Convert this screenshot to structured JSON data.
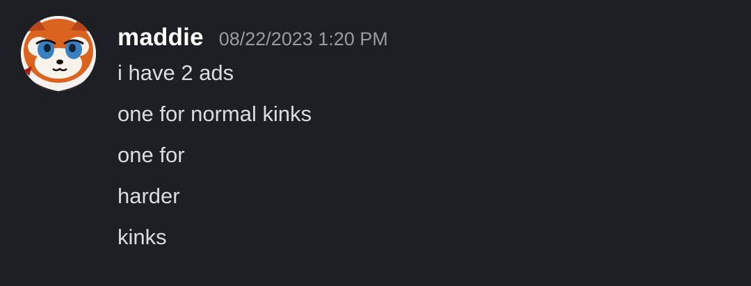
{
  "message": {
    "username": "maddie",
    "timestamp": "08/22/2023 1:20 PM",
    "avatar_icon": "red-panda-avatar-icon",
    "lines": [
      "i have 2 ads",
      "one for normal kinks",
      "one for",
      "harder",
      "kinks"
    ]
  },
  "colors": {
    "background": "#1e1f24",
    "username": "#ffffff",
    "timestamp": "#9a9ba3",
    "text": "#dcdde1"
  }
}
